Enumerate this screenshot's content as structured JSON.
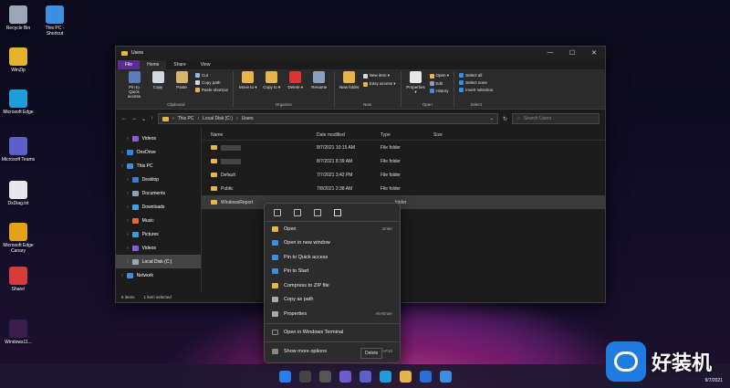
{
  "desktop": {
    "icons": [
      {
        "label": "Recycle Bin",
        "color": "#9aa7b8"
      },
      {
        "label": "This PC - Shortcut",
        "color": "#3b8ee0"
      },
      {
        "label": "WinZip",
        "color": "#e5b230"
      },
      {
        "label": "Microsoft Edge",
        "color": "#1c9fd8"
      },
      {
        "label": "Microsoft Teams",
        "color": "#5b5fc7"
      },
      {
        "label": "DxDiag.txt",
        "color": "#e8e8e8"
      },
      {
        "label": "Microsoft Edge Canary",
        "color": "#e3a21a"
      },
      {
        "label": "Share!",
        "color": "#d93a3a"
      },
      {
        "label": "Windows11...",
        "color": "#3a1d4a"
      }
    ]
  },
  "window": {
    "title": "Users",
    "controls": [
      "—",
      "☐",
      "✕"
    ]
  },
  "tabs": [
    "File",
    "Home",
    "Share",
    "View"
  ],
  "ribbon": {
    "clipboard": {
      "name": "Clipboard",
      "pin": "Pin to Quick access",
      "copy": "Copy",
      "paste": "Paste",
      "cut": "Cut",
      "copy_path": "Copy path",
      "paste_shortcut": "Paste shortcut"
    },
    "organize": {
      "name": "Organize",
      "move_to": "Move to ▾",
      "copy_to": "Copy to ▾",
      "delete": "Delete ▾",
      "rename": "Rename"
    },
    "new": {
      "name": "New",
      "new_folder": "New folder",
      "new_item": "New item ▾",
      "easy_access": "Easy access ▾"
    },
    "open": {
      "name": "Open",
      "properties": "Properties ▾",
      "open": "Open ▾",
      "edit": "Edit",
      "history": "History"
    },
    "select": {
      "name": "Select",
      "select_all": "Select all",
      "select_none": "Select none",
      "invert": "Invert selection"
    }
  },
  "address": {
    "path": [
      "This PC",
      "Local Disk (C:)",
      "Users"
    ],
    "search_placeholder": "Search Users"
  },
  "nav": [
    {
      "label": "Videos",
      "color": "#8a5cd6",
      "sel": false
    },
    {
      "label": "OneDrive",
      "color": "#2a86e0",
      "sel": false
    },
    {
      "label": "This PC",
      "color": "#3b8ee0",
      "sel": false
    },
    {
      "label": "Desktop",
      "color": "#3a7bd5",
      "sel": false
    },
    {
      "label": "Documents",
      "color": "#8fa3b8",
      "sel": false
    },
    {
      "label": "Downloads",
      "color": "#3fa4e6",
      "sel": false
    },
    {
      "label": "Music",
      "color": "#e06a3b",
      "sel": false
    },
    {
      "label": "Pictures",
      "color": "#39a0d8",
      "sel": false
    },
    {
      "label": "Videos",
      "color": "#8a5cd6",
      "sel": false
    },
    {
      "label": "Local Disk (C:)",
      "color": "#9aa7b8",
      "sel": true
    },
    {
      "label": "Network",
      "color": "#3b8ee0",
      "sel": false
    }
  ],
  "columns": [
    "Name",
    "Date modified",
    "Type",
    "Size"
  ],
  "files": [
    {
      "name": "",
      "date": "8/7/2021 10:15 AM",
      "type": "File folder",
      "sel": false
    },
    {
      "name": "",
      "date": "8/7/2021 8:39 AM",
      "type": "File folder",
      "sel": false
    },
    {
      "name": "Default",
      "date": "7/7/2021 3:42 PM",
      "type": "File folder",
      "sel": false
    },
    {
      "name": "Public",
      "date": "7/8/2021 2:38 AM",
      "type": "File folder",
      "sel": false
    },
    {
      "name": "WindowsReport",
      "date": "",
      "type": "folder",
      "sel": true
    }
  ],
  "status": {
    "items": "5 items",
    "selected": "1 item selected"
  },
  "context_menu": {
    "items": [
      {
        "label": "Open",
        "key": "Enter",
        "color": "#e7b64a"
      },
      {
        "label": "Open in new window",
        "key": "",
        "color": "#3b8ee0"
      },
      {
        "label": "Pin to Quick access",
        "key": "",
        "color": "#3b8ee0"
      },
      {
        "label": "Pin to Start",
        "key": "",
        "color": "#3b8ee0"
      },
      {
        "label": "Compress to ZIP file",
        "key": "",
        "color": "#e7b64a"
      },
      {
        "label": "Copy as path",
        "key": "",
        "color": "#aaaaaa"
      },
      {
        "label": "Properties",
        "key": "Alt+Enter",
        "color": "#aaaaaa"
      }
    ],
    "terminal": "Open in Windows Terminal",
    "more": "Show more options",
    "more_key": "Shift+F10"
  },
  "tooltip": "Delete",
  "tray": {
    "time": "",
    "date": "9/7/2021"
  },
  "watermark": "好装机"
}
